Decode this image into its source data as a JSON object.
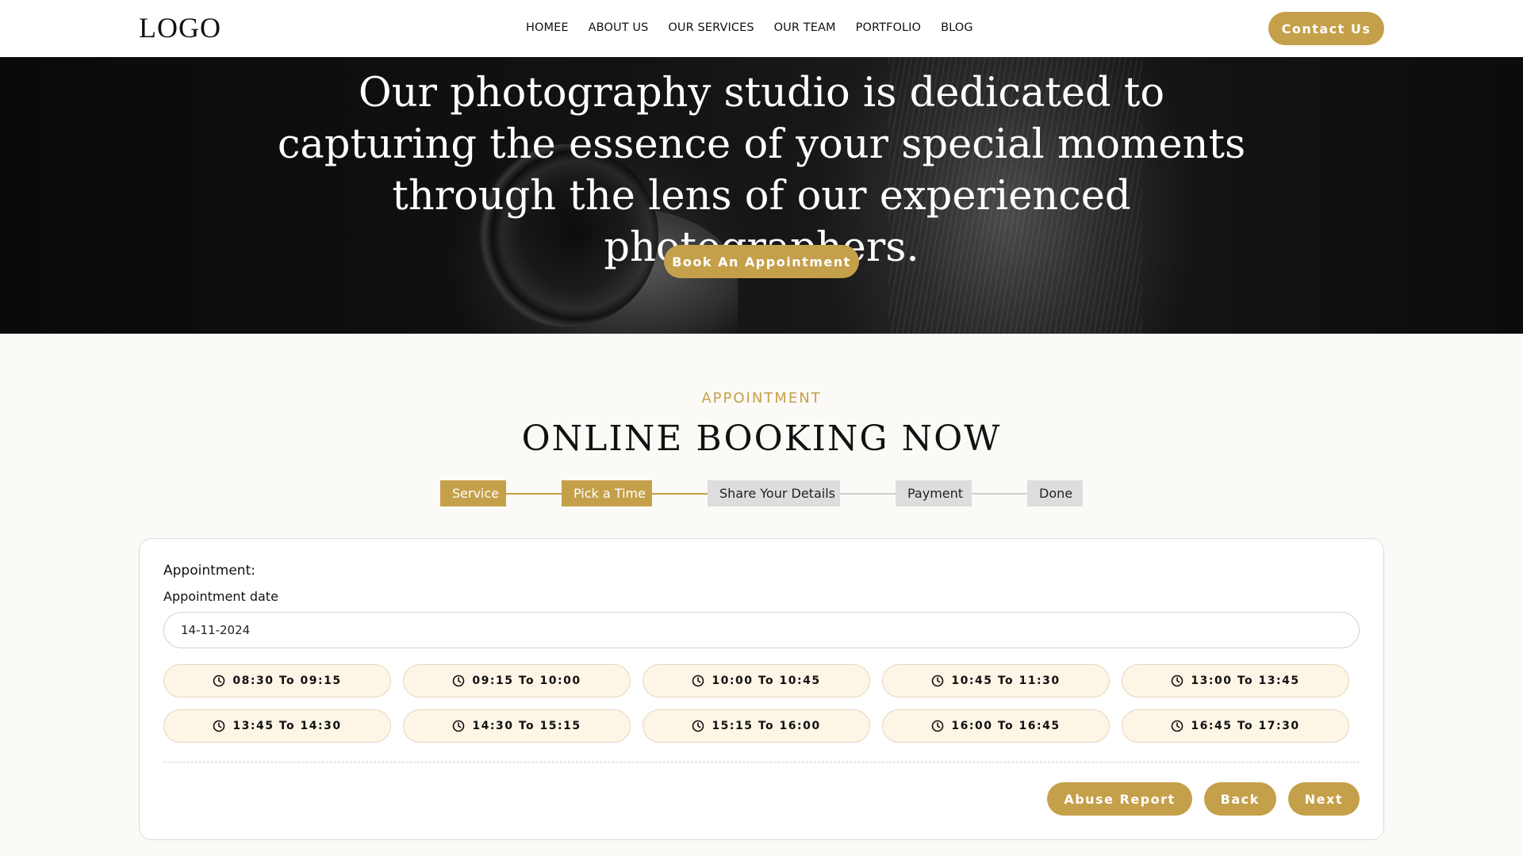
{
  "header": {
    "logo": "LOGO",
    "nav": [
      "HOMEE",
      "ABOUT US",
      "OUR SERVICES",
      "OUR TEAM",
      "PORTFOLIO",
      "BLOG"
    ],
    "contact_label": "Contact Us"
  },
  "hero": {
    "text": "Our photography studio is dedicated to capturing the essence of your special moments through the lens of our experienced photographers.",
    "button_label": "Book An Appointment"
  },
  "booking": {
    "eyebrow": "APPOINTMENT",
    "title": "ONLINE BOOKING NOW",
    "steps": [
      {
        "label": "Service",
        "state": "complete"
      },
      {
        "label": "Pick a Time",
        "state": "current"
      },
      {
        "label": "Share Your Details",
        "state": "pending"
      },
      {
        "label": "Payment",
        "state": "pending"
      },
      {
        "label": "Done",
        "state": "pending"
      }
    ],
    "card": {
      "heading": "Appointment:",
      "date_label": "Appointment date",
      "date_value": "14-11-2024",
      "slots": [
        "08:30 To 09:15",
        "09:15 To 10:00",
        "10:00 To 10:45",
        "10:45 To 11:30",
        "13:00 To 13:45",
        "13:45 To 14:30",
        "14:30 To 15:15",
        "15:15 To 16:00",
        "16:00 To 16:45",
        "16:45 To 17:30"
      ],
      "slot_icon": "clock-icon",
      "actions": [
        "Abuse Report",
        "Back",
        "Next"
      ]
    }
  },
  "colors": {
    "accent": "#c5a04a",
    "slot_bg": "#fdf5e6",
    "step_inactive": "#dddddd"
  }
}
